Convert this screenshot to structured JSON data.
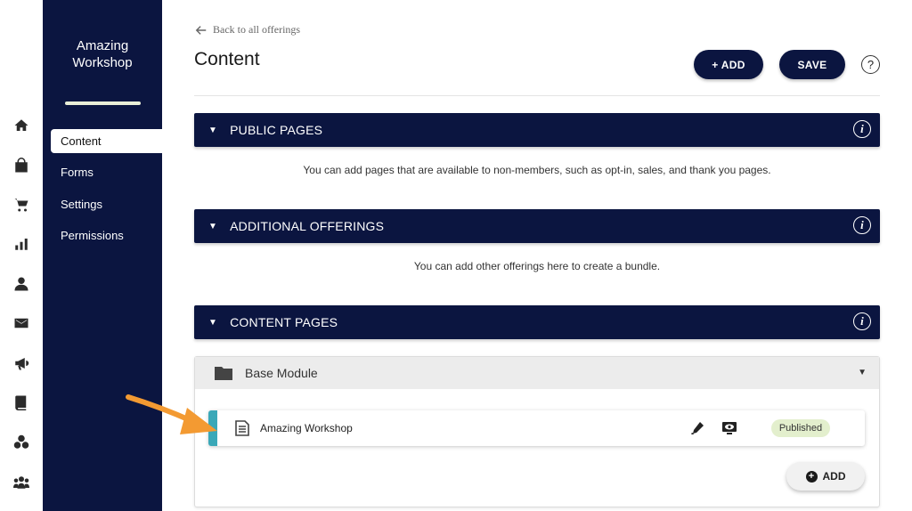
{
  "rail": {
    "icons": [
      "home-icon",
      "store-icon",
      "cart-icon",
      "bar-chart-icon",
      "user-icon",
      "mail-icon",
      "megaphone-icon",
      "book-icon",
      "community-icon",
      "team-icon"
    ]
  },
  "sidebar": {
    "brand_line1": "Amazing",
    "brand_line2": "Workshop",
    "items": [
      {
        "label": "Content",
        "active": true
      },
      {
        "label": "Forms"
      },
      {
        "label": "Settings"
      },
      {
        "label": "Permissions"
      }
    ]
  },
  "header": {
    "back_label": "Back to all offerings",
    "title": "Content",
    "add_label": "+ ADD",
    "save_label": "SAVE",
    "help_label": "?"
  },
  "sections": {
    "public": {
      "title": "PUBLIC PAGES",
      "description": "You can add pages that are available to non-members, such as opt-in, sales, and thank you pages."
    },
    "additional": {
      "title": "ADDITIONAL OFFERINGS",
      "description": "You can add other offerings here to create a bundle."
    },
    "content": {
      "title": "CONTENT PAGES"
    }
  },
  "module": {
    "title": "Base Module",
    "pages": [
      {
        "title": "Amazing Workshop",
        "status": "Published"
      }
    ],
    "add_label": "ADD"
  },
  "colors": {
    "navy": "#0b1540",
    "accent_teal": "#3aa8b8",
    "published_badge": "#e3efcd",
    "annotation_arrow": "#f39a32"
  }
}
